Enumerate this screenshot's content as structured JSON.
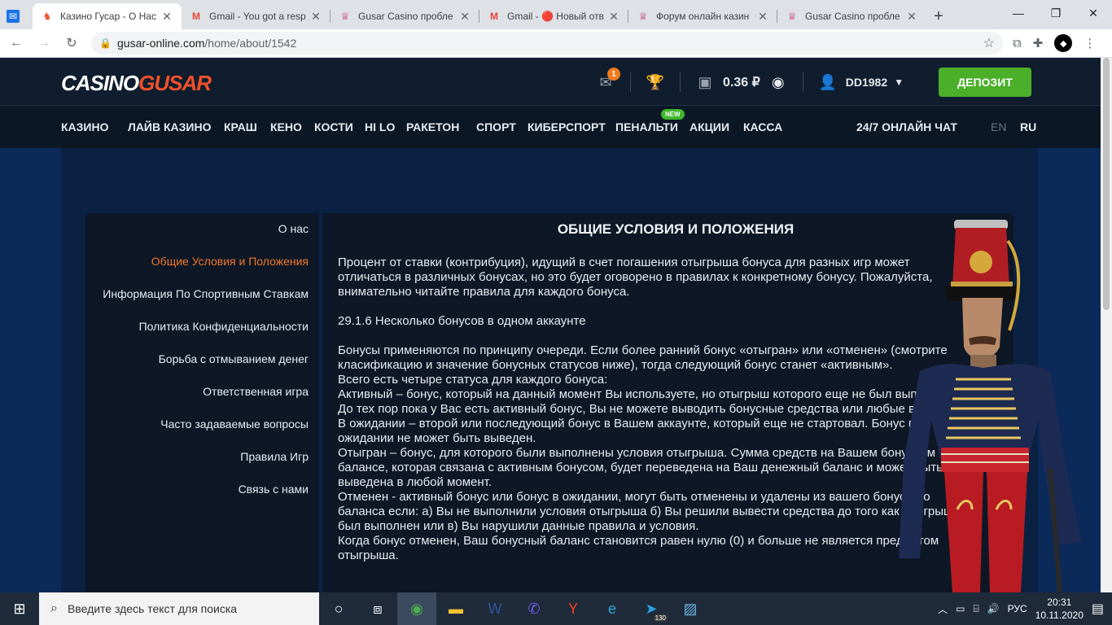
{
  "browser": {
    "tabs": [
      {
        "icon": "casino-favicon",
        "title": "Казино Гусар - О Нас",
        "active": true
      },
      {
        "icon": "gmail-icon",
        "title": "Gmail - You got a resp"
      },
      {
        "icon": "forum-favicon",
        "title": "Gusar Casino пробле"
      },
      {
        "icon": "gmail-icon",
        "title": "Gmail - 🔴 Новый отв"
      },
      {
        "icon": "forum-favicon",
        "title": "Форум онлайн казин"
      },
      {
        "icon": "forum-favicon",
        "title": "Gusar Casino пробле"
      }
    ],
    "url_host": "gusar-online.com",
    "url_path": "/home/about/1542"
  },
  "header": {
    "logo_part1": "CASINO",
    "logo_part2": "GUSAR",
    "mail_badge": "1",
    "balance": "0.36 ₽",
    "username": "DD1982",
    "deposit_label": "ДЕПОЗИТ"
  },
  "nav": {
    "items": [
      "КАЗИНО",
      "ЛАЙВ КАЗИНО",
      "КРАШ",
      "КЕНО",
      "КОСТИ",
      "HI LO",
      "РАКЕТОН",
      "СПОРТ",
      "КИБЕРСПОРТ",
      "ПЕНАЛЬТИ",
      "АКЦИИ",
      "КАССА"
    ],
    "new_badge": "NEW",
    "chat": "24/7 ОНЛАЙН ЧАТ",
    "lang_en": "EN",
    "lang_ru": "RU"
  },
  "sidebar": {
    "items": [
      "О нас",
      "Общие Условия и Положения",
      "Информация По Спортивным Ставкам",
      "Политика Конфиденциальности",
      "Борьба с отмыванием денег",
      "Ответственная игра",
      "Часто задаваемые вопросы",
      "Правила Игр",
      "Связь с нами"
    ],
    "active_index": 1
  },
  "content": {
    "title": "ОБЩИЕ УСЛОВИЯ И ПОЛОЖЕНИЯ",
    "p1": "Процент от ставки (контрибуция), идущий в счет погашения отыгрыша бонуса для разных игр может отличаться в различных бонусах, но это будет оговорено в правилах к конкретному бонусу. Пожалуйста, внимательно читайте правила для каждого бонуса.",
    "p2": "29.1.6 Несколько бонусов в одном аккаунте",
    "p3": "Бонусы применяются по принципу очереди. Если более ранний бонус «отыгран» или «отменен» (смотрите класификацию и значение бонусных статусов ниже), тогда следующий бонус станет «активным».",
    "p4": "Всего есть четыре статуса для каждого бонуса:",
    "p5": "Активный – бонус, который на данный момент Вы используете, но отыгрыш которого еще не был выполнен. До тех пор пока у Вас есть активный бонус, Вы не можете выводить бонусные средства или любые выигрыши.",
    "p6": "В ожидании – второй или последующий бонус в Вашем аккаунте, который еще не стартовал. Бонус в ожидании не может быть выведен.",
    "p7": "Отыгран – бонус, для которого были выполнены условия отыгрыша. Сумма средств на Вашем бонусном балансе, которая связана с активным бонусом, будет переведена на Ваш денежный баланс и может быть выведена в любой момент.",
    "p8": "Отменен - активный бонус или бонус в ожидании, могут быть отменены и удалены из вашего бонусного баланса если: а) Вы не выполнили условия отыгрыша б) Вы решили вывести средства до того как отыгрыш был выполнен или в) Вы нарушили данные правила и условия.",
    "p9": "Когда бонус отменен, Ваш бонусный баланс становится равен нулю (0) и больше не является предметом отыгрыша."
  },
  "taskbar": {
    "search_placeholder": "Введите здесь текст для поиска",
    "telegram_badge": "130",
    "lang": "РУС",
    "time": "20:31",
    "date": "10.11.2020"
  }
}
